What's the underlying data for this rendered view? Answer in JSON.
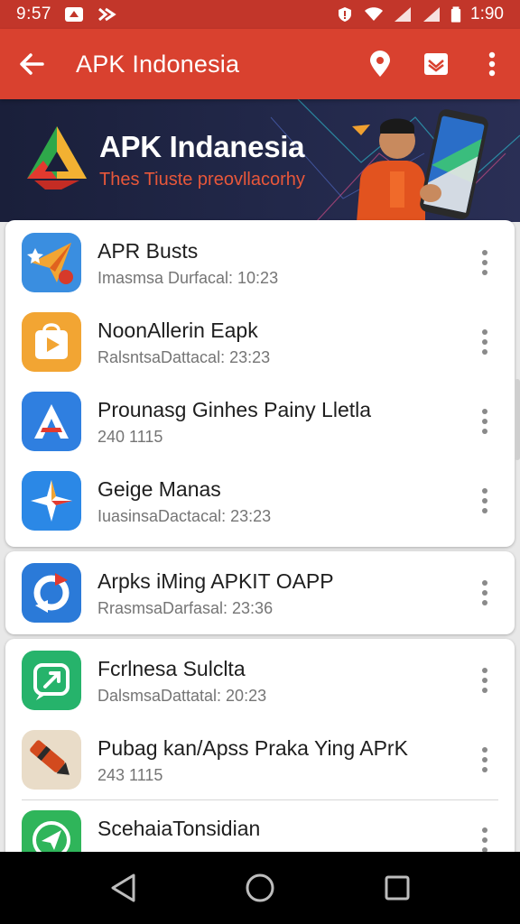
{
  "status_bar": {
    "time": "9:57",
    "battery_time": "1:90"
  },
  "app_bar": {
    "title": "APK Indonesia"
  },
  "banner": {
    "title": "APK Indanesia",
    "subtitle": "Thes Tiuste preovllacorhy"
  },
  "apps": [
    {
      "name": "APR Busts",
      "meta": "Imasmsa Durfacal: 10:23",
      "icon": "paper-plane-star-icon",
      "color": "#3a8ee0"
    },
    {
      "name": "NoonAllerin Eapk",
      "meta": "RalsntsaDattacal: 23:23",
      "icon": "play-bag-icon",
      "color": "#f2a533"
    },
    {
      "name": "Prounasg Ginhes Painy Lletla",
      "meta": "240 1115",
      "icon": "letter-a-icon",
      "color": "#2f7fe0"
    },
    {
      "name": "Geige Manas",
      "meta": "IuasinsaDactacal: 23:23",
      "icon": "star-compass-icon",
      "color": "#2b88e6"
    },
    {
      "name": "Arpks iMing APKIT OAPP",
      "meta": "RrasmsaDarfasal: 23:36",
      "icon": "circular-arrows-icon",
      "color": "#2b7ad8"
    },
    {
      "name": "Fcrlnesa Sulclta",
      "meta": "DalsmsaDattatal: 20:23",
      "icon": "chat-arrow-icon",
      "color": "#26b36b"
    },
    {
      "name": "Pubag kan/Apss Praka Ying APrK",
      "meta": "243 1115",
      "icon": "pen-tool-icon",
      "color": "#e9dcc8"
    },
    {
      "name": "ScehaiaTonsidian",
      "meta": "",
      "icon": "send-arrow-icon",
      "color": "#2fb55a"
    }
  ]
}
